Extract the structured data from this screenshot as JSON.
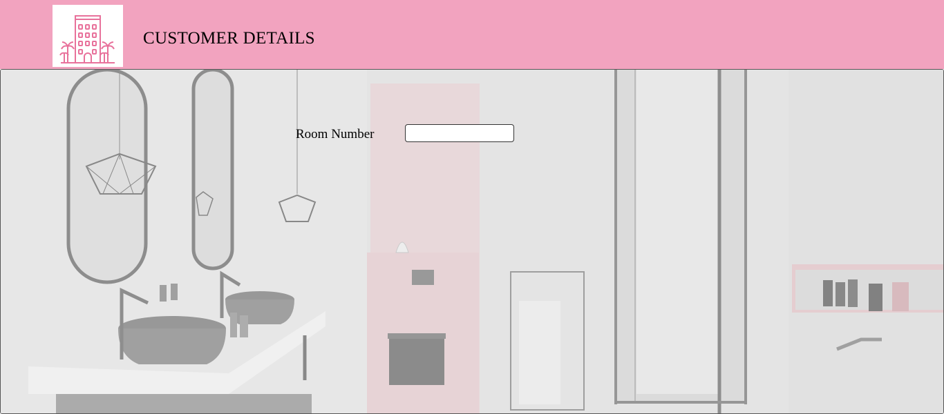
{
  "header": {
    "title": "CUSTOMER DETAILS",
    "logo_icon": "hotel-building-palms-icon",
    "background_color": "#f2a3bf",
    "accent_color": "#e8719b"
  },
  "form": {
    "room_number_label": "Room Number",
    "room_number_value": ""
  },
  "background": {
    "image_icon": "bathroom-photo",
    "tint_color": "#e4e4e4",
    "accent_wall_color": "#efc9cf"
  }
}
